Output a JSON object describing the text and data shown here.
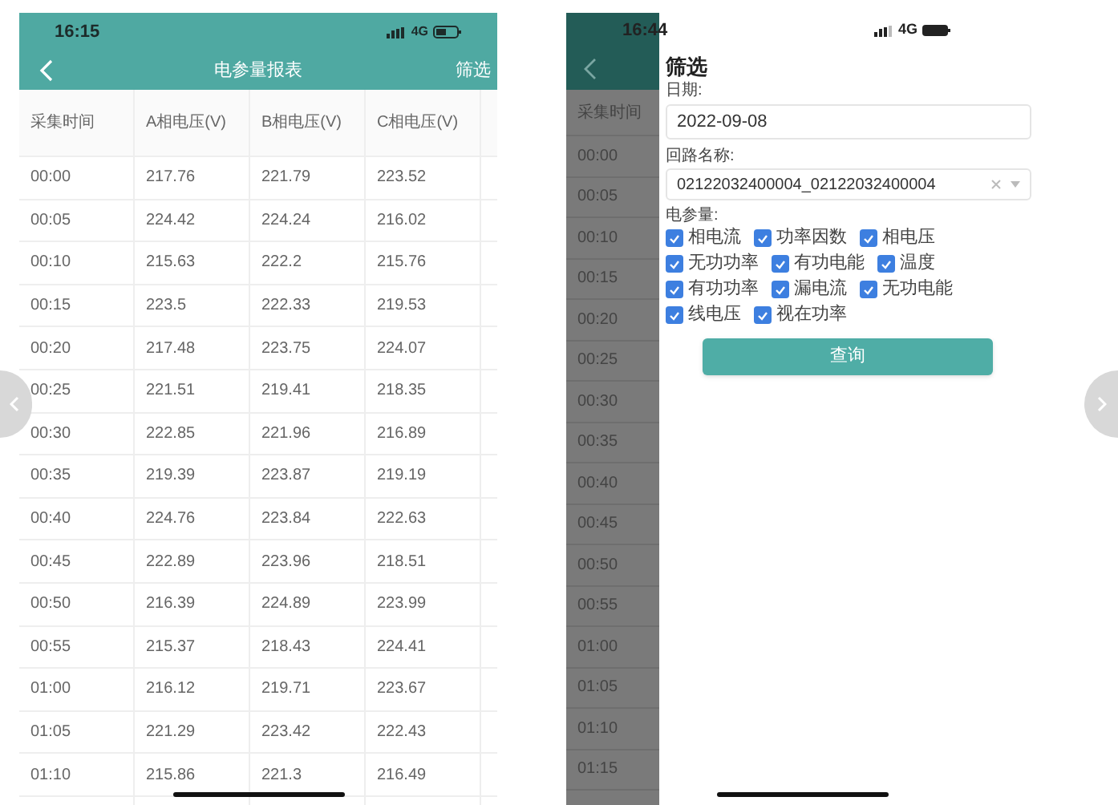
{
  "report_screen": {
    "status_bar": {
      "time": "16:15",
      "network": "4G"
    },
    "title": "电参量报表",
    "filter_button": "筛选",
    "table": {
      "columns": [
        "采集时间",
        "A相电压(V)",
        "B相电压(V)",
        "C相电压(V)"
      ],
      "rows": [
        [
          "00:00",
          "217.76",
          "221.79",
          "223.52"
        ],
        [
          "00:05",
          "224.42",
          "224.24",
          "216.02"
        ],
        [
          "00:10",
          "215.63",
          "222.2",
          "215.76"
        ],
        [
          "00:15",
          "223.5",
          "222.33",
          "219.53"
        ],
        [
          "00:20",
          "217.48",
          "223.75",
          "224.07"
        ],
        [
          "00:25",
          "221.51",
          "219.41",
          "218.35"
        ],
        [
          "00:30",
          "222.85",
          "221.96",
          "216.89"
        ],
        [
          "00:35",
          "219.39",
          "223.87",
          "219.19"
        ],
        [
          "00:40",
          "224.76",
          "223.84",
          "222.63"
        ],
        [
          "00:45",
          "222.89",
          "223.96",
          "218.51"
        ],
        [
          "00:50",
          "216.39",
          "224.89",
          "223.99"
        ],
        [
          "00:55",
          "215.37",
          "218.43",
          "224.41"
        ],
        [
          "01:00",
          "216.12",
          "219.71",
          "223.67"
        ],
        [
          "01:05",
          "221.29",
          "223.42",
          "222.43"
        ],
        [
          "01:10",
          "215.86",
          "221.3",
          "216.49"
        ]
      ]
    }
  },
  "filter_screen": {
    "status_bar": {
      "time": "16:44",
      "network": "4G"
    },
    "background_table": {
      "column": "采集时间",
      "rows": [
        "00:00",
        "00:05",
        "00:10",
        "00:15",
        "00:20",
        "00:25",
        "00:30",
        "00:35",
        "00:40",
        "00:45",
        "00:50",
        "00:55",
        "01:00",
        "01:05",
        "01:10",
        "01:15"
      ]
    },
    "panel": {
      "title": "筛选",
      "date_label": "日期:",
      "date_value": "2022-09-08",
      "circuit_label": "回路名称:",
      "circuit_value": "02122032400004_02122032400004",
      "params_label": "电参量:",
      "params": [
        {
          "label": "相电流",
          "checked": true
        },
        {
          "label": "功率因数",
          "checked": true
        },
        {
          "label": "相电压",
          "checked": true
        },
        {
          "label": "无功功率",
          "checked": true
        },
        {
          "label": "有功电能",
          "checked": true
        },
        {
          "label": "温度",
          "checked": true
        },
        {
          "label": "有功功率",
          "checked": true
        },
        {
          "label": "漏电流",
          "checked": true
        },
        {
          "label": "无功电能",
          "checked": true
        },
        {
          "label": "线电压",
          "checked": true
        },
        {
          "label": "视在功率",
          "checked": true
        }
      ],
      "query_button": "查询"
    }
  }
}
